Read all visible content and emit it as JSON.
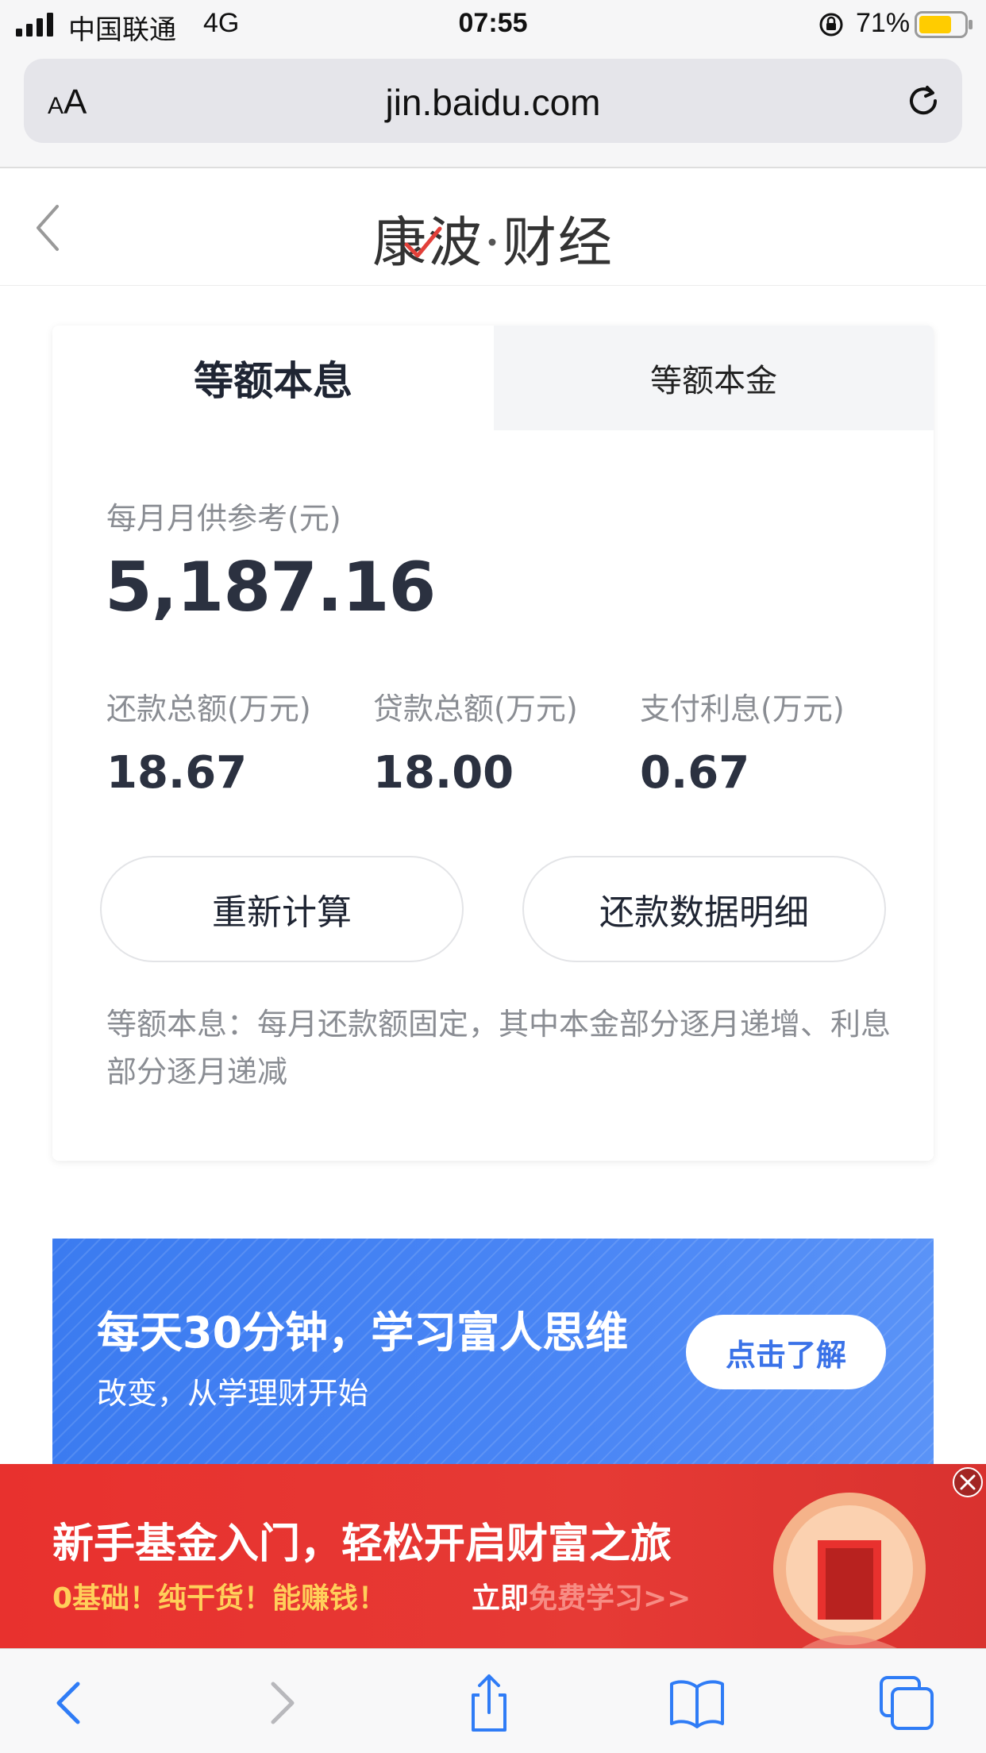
{
  "status_bar": {
    "carrier": "中国联通",
    "network": "4G",
    "time": "07:55",
    "battery": "71%"
  },
  "browser": {
    "aa_small": "A",
    "aa_large": "A",
    "url": "jin.baidu.com"
  },
  "header": {
    "brand_left": "康波",
    "brand_sep": "·",
    "brand_right": "财经"
  },
  "tabs": [
    {
      "label": "等额本息",
      "active": true
    },
    {
      "label": "等额本金",
      "active": false
    }
  ],
  "result": {
    "monthly_label": "每月月供参考(元)",
    "monthly_value": "5,187.16",
    "stats": [
      {
        "label": "还款总额(万元)",
        "value": "18.67"
      },
      {
        "label": "贷款总额(万元)",
        "value": "18.00"
      },
      {
        "label": "支付利息(万元)",
        "value": "0.67"
      }
    ],
    "recalc_label": "重新计算",
    "detail_label": "还款数据明细",
    "description": "等额本息：每月还款额固定，其中本金部分逐月递增、利息部分逐月递减"
  },
  "banner": {
    "title": "每天30分钟，学习富人思维",
    "subtitle": "改变，从学理财开始",
    "button": "点击了解"
  },
  "ad": {
    "title": "新手基金入门，轻松开启财富之旅",
    "subtitle": "0基础！纯干货！能赚钱！",
    "cta_white": "立即",
    "cta_faded": "免费学习>>"
  },
  "colors": {
    "accent_blue": "#3b7bf0",
    "ad_red": "#e8312e",
    "ad_yellow": "#ffcf5a",
    "battery_yellow": "#ffcc00"
  }
}
